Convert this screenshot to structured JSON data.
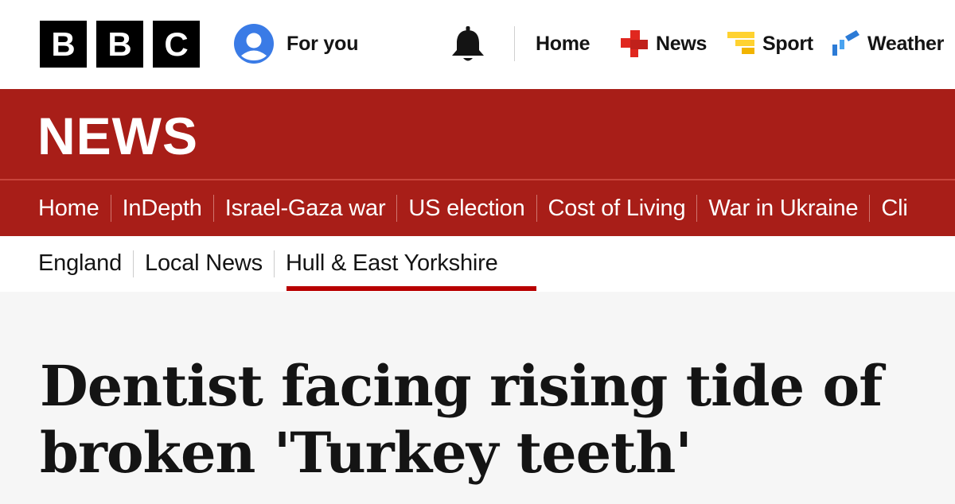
{
  "masthead": {
    "logo_letters": [
      "B",
      "B",
      "C"
    ],
    "for_you_label": "For you",
    "for_you_icon": "user-avatar-icon",
    "notifications_icon": "bell-icon",
    "nav": [
      {
        "label": "Home",
        "icon": ""
      },
      {
        "label": "News",
        "icon": "news-squares-icon"
      },
      {
        "label": "Sport",
        "icon": "sport-bars-icon"
      },
      {
        "label": "Weather",
        "icon": "weather-icon"
      }
    ]
  },
  "section": {
    "wordmark": "NEWS"
  },
  "primary_nav": [
    "Home",
    "InDepth",
    "Israel-Gaza war",
    "US election",
    "Cost of Living",
    "War in Ukraine",
    "Cli"
  ],
  "secondary_nav": {
    "items": [
      "England",
      "Local News",
      "Hull & East Yorkshire"
    ],
    "active": "Hull & East Yorkshire"
  },
  "article": {
    "headline_line1": "Dentist facing rising tide of",
    "headline_line2": "broken 'Turkey teeth'"
  },
  "colors": {
    "news_red": "#a81e18",
    "active_underline": "#b80000",
    "avatar_blue": "#3a7be6",
    "sport_yellow": "#ffd230",
    "weather_blue": "#2c7bd6"
  }
}
